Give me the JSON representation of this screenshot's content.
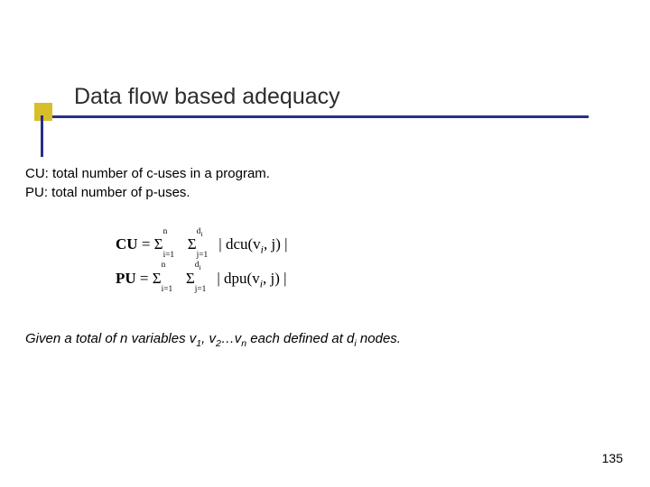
{
  "title": "Data flow based adequacy",
  "defs": {
    "cu": "CU: total number of c-uses in a program.",
    "pu": "PU: total number of p-uses."
  },
  "formula_cu": {
    "lhs": "CU",
    "eq": " = ",
    "sigma1_sup": "n",
    "sigma1_sub": "i=1",
    "sigma2_sup": "d",
    "sigma2_sup_sub": "i",
    "sigma2_sub": "j=1",
    "body": " | dcu(v",
    "var_sub": "i",
    "body2": ", j) |"
  },
  "formula_pu": {
    "lhs": "PU",
    "eq": " = ",
    "sigma1_sup": "n",
    "sigma1_sub": "i=1",
    "sigma2_sup": "d",
    "sigma2_sup_sub": "i",
    "sigma2_sub": "j=1",
    "body": " | dpu(v",
    "var_sub": "i",
    "body2": ", j) |"
  },
  "tail": {
    "p1": "Given a total of n variables v",
    "s1": "1",
    "p2": ", v",
    "s2": "2",
    "p3": "…v",
    "s3": "n",
    "p4": "  each defined at d",
    "s4": "i",
    "p5": " nodes."
  },
  "page_number": "135"
}
